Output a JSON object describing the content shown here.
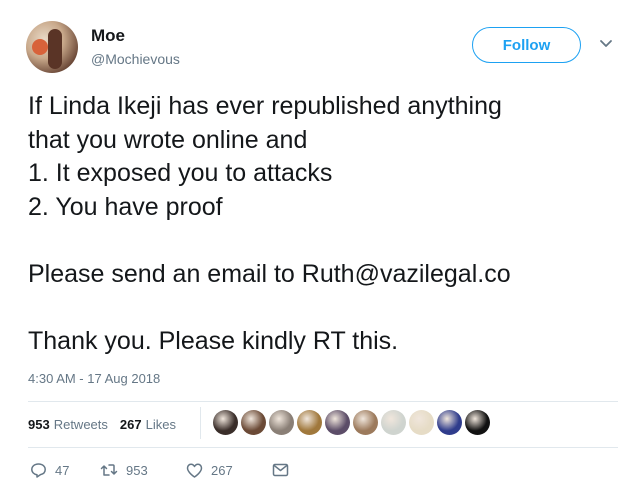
{
  "user": {
    "display_name": "Moe",
    "handle": "@Mochievous"
  },
  "follow_label": "Follow",
  "tweet": {
    "lines": [
      "If Linda Ikeji has ever republished anything",
      "that you wrote online and",
      "1. It exposed you to attacks",
      "2. You have proof",
      "",
      "Please send an email to Ruth@vazilegal.co",
      "",
      "Thank you. Please kindly RT this."
    ],
    "timestamp": "4:30 AM - 17 Aug 2018"
  },
  "stats": {
    "retweets_count": "953",
    "retweets_label": "Retweets",
    "likes_count": "267",
    "likes_label": "Likes"
  },
  "likers": [
    {
      "color": "#3a2e2a"
    },
    {
      "color": "#6b4a36"
    },
    {
      "color": "#8a7f76"
    },
    {
      "color": "#a0783c"
    },
    {
      "color": "#5c4d68"
    },
    {
      "color": "#9c7a5c"
    },
    {
      "color": "#cfd4cf"
    },
    {
      "color": "#e6dcc6"
    },
    {
      "color": "#2f3c8c"
    },
    {
      "color": "#111111"
    }
  ],
  "actions": {
    "reply_count": "47",
    "retweet_count": "953",
    "like_count": "267"
  },
  "colors": {
    "accent": "#1da1f2",
    "text": "#14171a",
    "muted": "#657786",
    "divider": "#e1e8ed"
  }
}
